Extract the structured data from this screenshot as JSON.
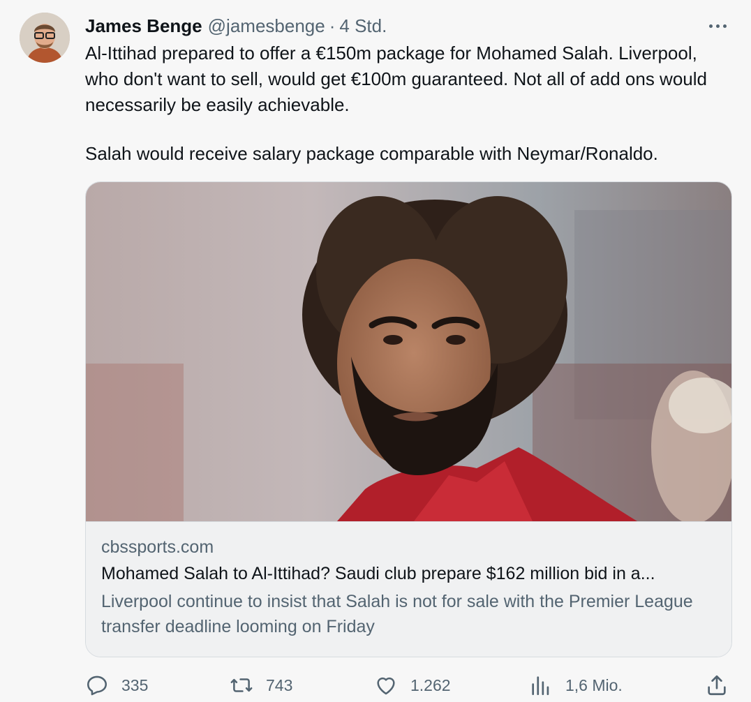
{
  "tweet": {
    "author": {
      "name": "James Benge",
      "handle": "@jamesbenge",
      "separator": "·",
      "timestamp": "4 Std."
    },
    "paragraphs": [
      "Al-Ittihad prepared to offer a €150m package for Mohamed Salah. Liverpool, who don't want to sell, would get €100m guaranteed. Not all of add ons would necessarily be easily achievable.",
      "Salah would receive salary package comparable with Neymar/Ronaldo."
    ],
    "card": {
      "domain": "cbssports.com",
      "title": "Mohamed Salah to Al-Ittihad? Saudi club prepare $162 million bid in a...",
      "description": "Liverpool continue to insist that Salah is not for sale with the Premier League transfer deadline looming on Friday"
    },
    "actions": {
      "replies": "335",
      "retweets": "743",
      "likes": "1.262",
      "views": "1,6 Mio."
    },
    "icons": {
      "more": "more-icon",
      "reply": "reply-icon",
      "retweet": "retweet-icon",
      "like": "heart-icon",
      "views": "analytics-icon",
      "share": "share-icon"
    },
    "colors": {
      "text": "#0f1419",
      "secondary": "#536471",
      "background": "#f7f7f7",
      "border": "#d6dbdf"
    }
  }
}
